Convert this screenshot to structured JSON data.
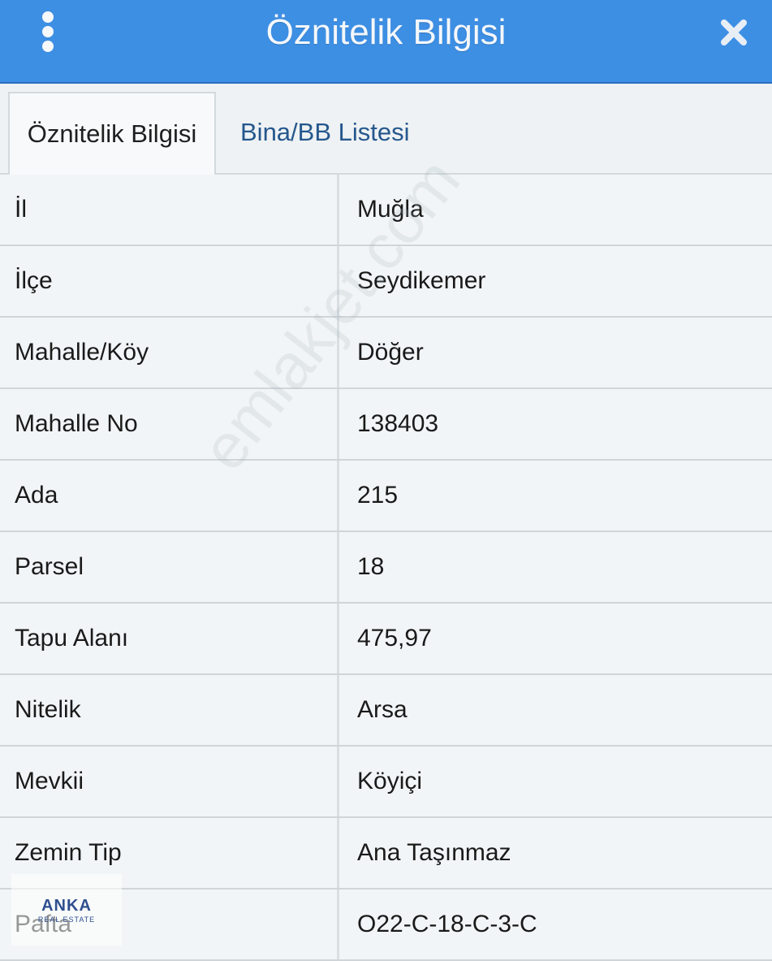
{
  "header": {
    "title": "Öznitelik Bilgisi",
    "menu_icon": "vertical-dots-icon",
    "close_icon": "close-icon"
  },
  "tabs": [
    {
      "label": "Öznitelik Bilgisi",
      "active": true
    },
    {
      "label": "Bina/BB Listesi",
      "active": false
    }
  ],
  "rows": [
    {
      "label": "İl",
      "value": "Muğla"
    },
    {
      "label": "İlçe",
      "value": "Seydikemer"
    },
    {
      "label": "Mahalle/Köy",
      "value": "Döğer"
    },
    {
      "label": "Mahalle No",
      "value": "138403"
    },
    {
      "label": "Ada",
      "value": "215"
    },
    {
      "label": "Parsel",
      "value": "18"
    },
    {
      "label": "Tapu Alanı",
      "value": "475,97"
    },
    {
      "label": "Nitelik",
      "value": "Arsa"
    },
    {
      "label": "Mevkii",
      "value": "Köyiçi"
    },
    {
      "label": "Zemin Tip",
      "value": "Ana Taşınmaz"
    },
    {
      "label": "Pafta",
      "value": "O22-C-18-C-3-C"
    }
  ],
  "watermark": "emlakjet.com",
  "logo": {
    "name": "ANKA",
    "sub": "REAL ESTATE"
  },
  "colors": {
    "header_bg": "#3d8fe4",
    "tab_inactive_text": "#25578d"
  }
}
